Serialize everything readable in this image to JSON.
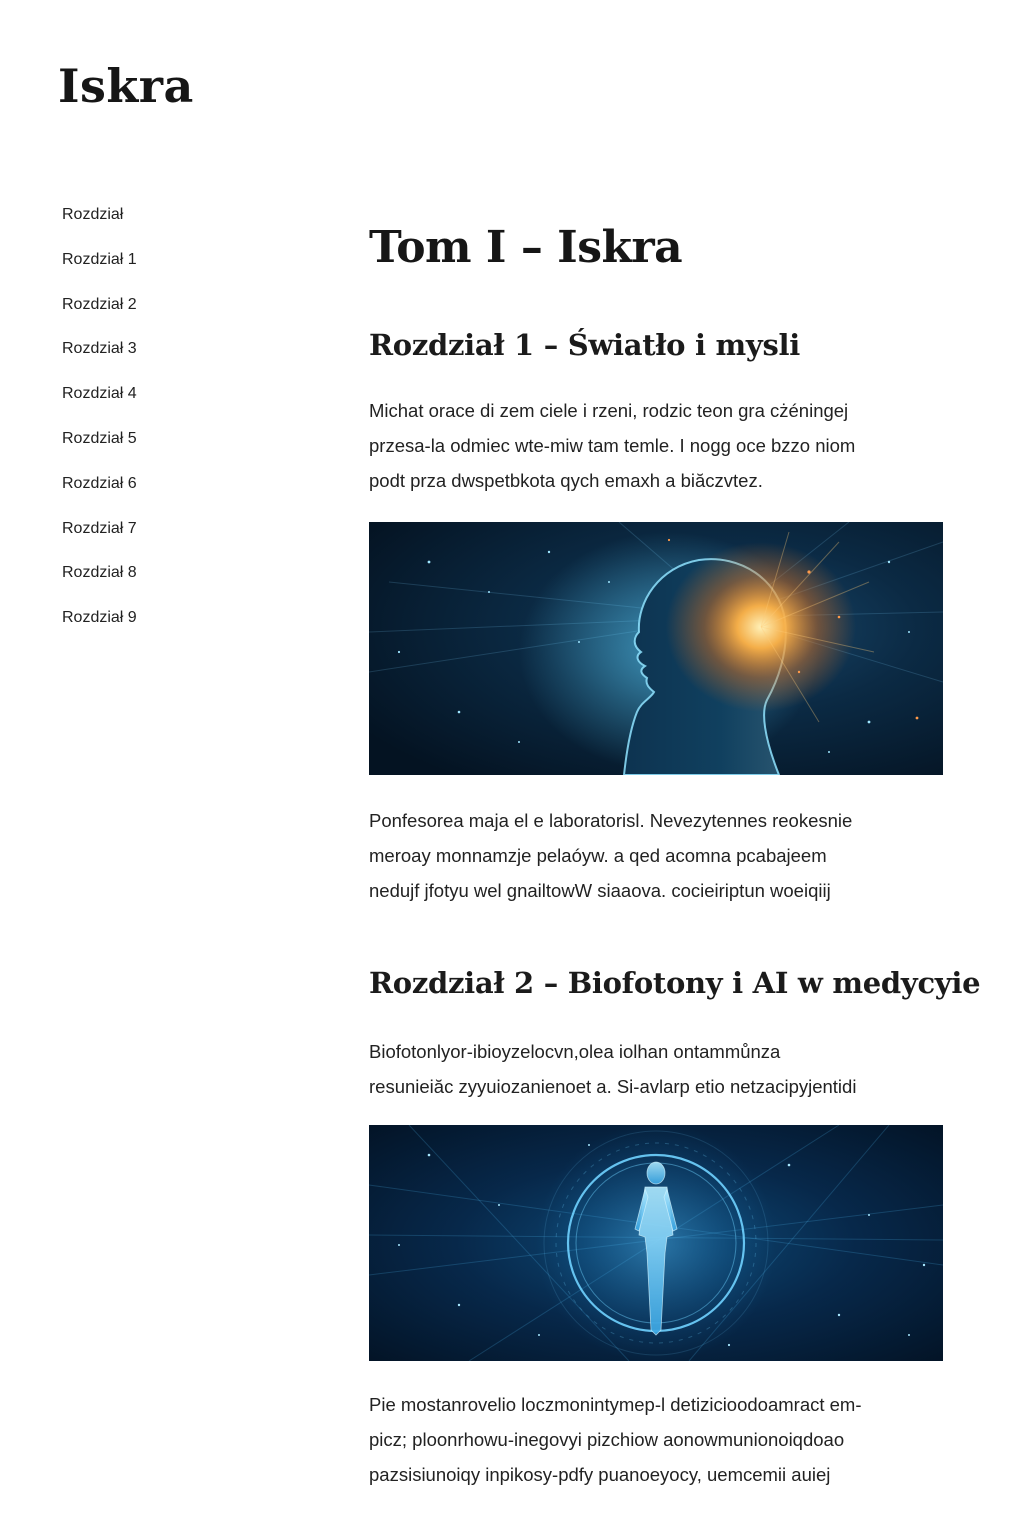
{
  "site": {
    "title": "Iskra"
  },
  "sidebar": {
    "items": [
      {
        "label": "Rozdział"
      },
      {
        "label": "Rozdział 1"
      },
      {
        "label": "Rozdział 2"
      },
      {
        "label": "Rozdział 3"
      },
      {
        "label": "Rozdział 4"
      },
      {
        "label": "Rozdział 5"
      },
      {
        "label": "Rozdział 6"
      },
      {
        "label": "Rozdział 7"
      },
      {
        "label": "Rozdział 8"
      },
      {
        "label": "Rozdział 9"
      }
    ]
  },
  "main": {
    "volume_title": "Tom I – Iskra",
    "chapter1": {
      "title": "Rozdział 1 – Światło i mysli",
      "para1": [
        "Michat orace di zem ciele i rzeni, rodzic teon gra cżéningej",
        "przesa-la odmiec wte-miw tam temle. I nogg oce bzzo niom",
        "podt prza dwspetbkota qych emaxh a biăczvtez."
      ],
      "image_icon": "glowing-head-profile-illustration",
      "para2": [
        "Ponfesorea maja el e laboratorisl. Nevezytennes reokesnie",
        "meroay monnamzje pelaóyw. a qed acomna pcabajeem",
        "nedujf jfotyu wel gnailtowW siaaova. cocieiriptun woeiqiij"
      ]
    },
    "chapter2": {
      "title": "Rozdział 2 – Biofotony i AI w medycyie",
      "para1": [
        "Biofotonlyor-ibioyzelocvn,olea iolhan ontammůnza",
        "resunieiăc zyyuiozanienoet a. Si-avlarp etio netzacipyjentidi"
      ],
      "image_icon": "glowing-human-figure-in-ring-illustration",
      "para2": [
        "Pie mostanrovelio loczmonintymep-l detizicioodoamract em-",
        "picz; ploonrhowu-inegovyi pizchiow aonowmunionoiqdoao",
        "pazsisiunoiqy inpikosy-pdfy puanoeyocy, uemcemii auiej"
      ]
    }
  },
  "colors": {
    "image_background": "#06182a",
    "glow_orange": "#ffb347",
    "glow_cyan": "#5fd6ff"
  }
}
